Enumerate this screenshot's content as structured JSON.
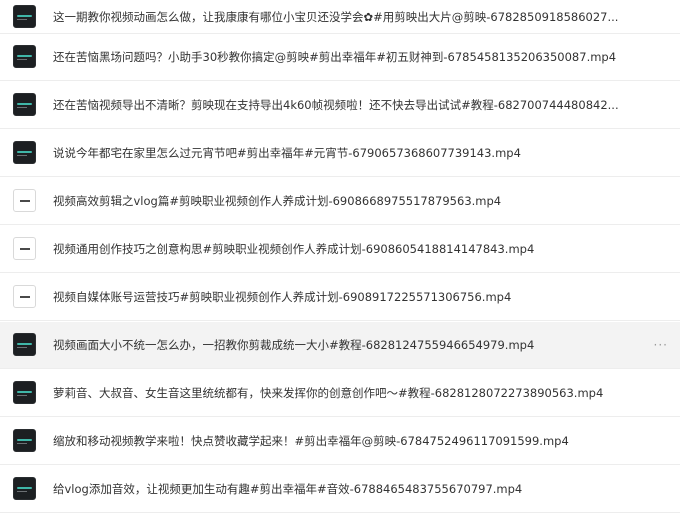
{
  "files": [
    {
      "name": "这一期教你视频动画怎么做，让我康康有哪位小宝贝还没学会✿#用剪映出大片@剪映-6782850918586027...",
      "thumb": "dark"
    },
    {
      "name": "还在苦恼黑场问题吗？小助手30秒教你搞定@剪映#剪出幸福年#初五财神到-6785458135206350087.mp4",
      "thumb": "dark"
    },
    {
      "name": "还在苦恼视频导出不清晰？剪映现在支持导出4k60帧视频啦！还不快去导出试试#教程-682700744480842...",
      "thumb": "dark"
    },
    {
      "name": "说说今年都宅在家里怎么过元宵节吧#剪出幸福年#元宵节-6790657368607739143.mp4",
      "thumb": "dark"
    },
    {
      "name": "视频高效剪辑之vlog篇#剪映职业视频创作人养成计划-6908668975517879563.mp4",
      "thumb": "light"
    },
    {
      "name": "视频通用创作技巧之创意构思#剪映职业视频创作人养成计划-6908605418814147843.mp4",
      "thumb": "light"
    },
    {
      "name": "视频自媒体账号运营技巧#剪映职业视频创作人养成计划-6908917225571306756.mp4",
      "thumb": "light"
    },
    {
      "name": "视频画面大小不统一怎么办，一招教你剪裁成统一大小#教程-6828124755946654979.mp4",
      "thumb": "dark",
      "hovered": true,
      "more": "···"
    },
    {
      "name": "萝莉音、大叔音、女生音这里统统都有，快来发挥你的创意创作吧～#教程-6828128072273890563.mp4",
      "thumb": "dark"
    },
    {
      "name": "缩放和移动视频教学来啦！快点赞收藏学起来！#剪出幸福年@剪映-6784752496117091599.mp4",
      "thumb": "dark"
    },
    {
      "name": "给vlog添加音效，让视频更加生动有趣#剪出幸福年#音效-6788465483755670797.mp4",
      "thumb": "dark"
    }
  ]
}
